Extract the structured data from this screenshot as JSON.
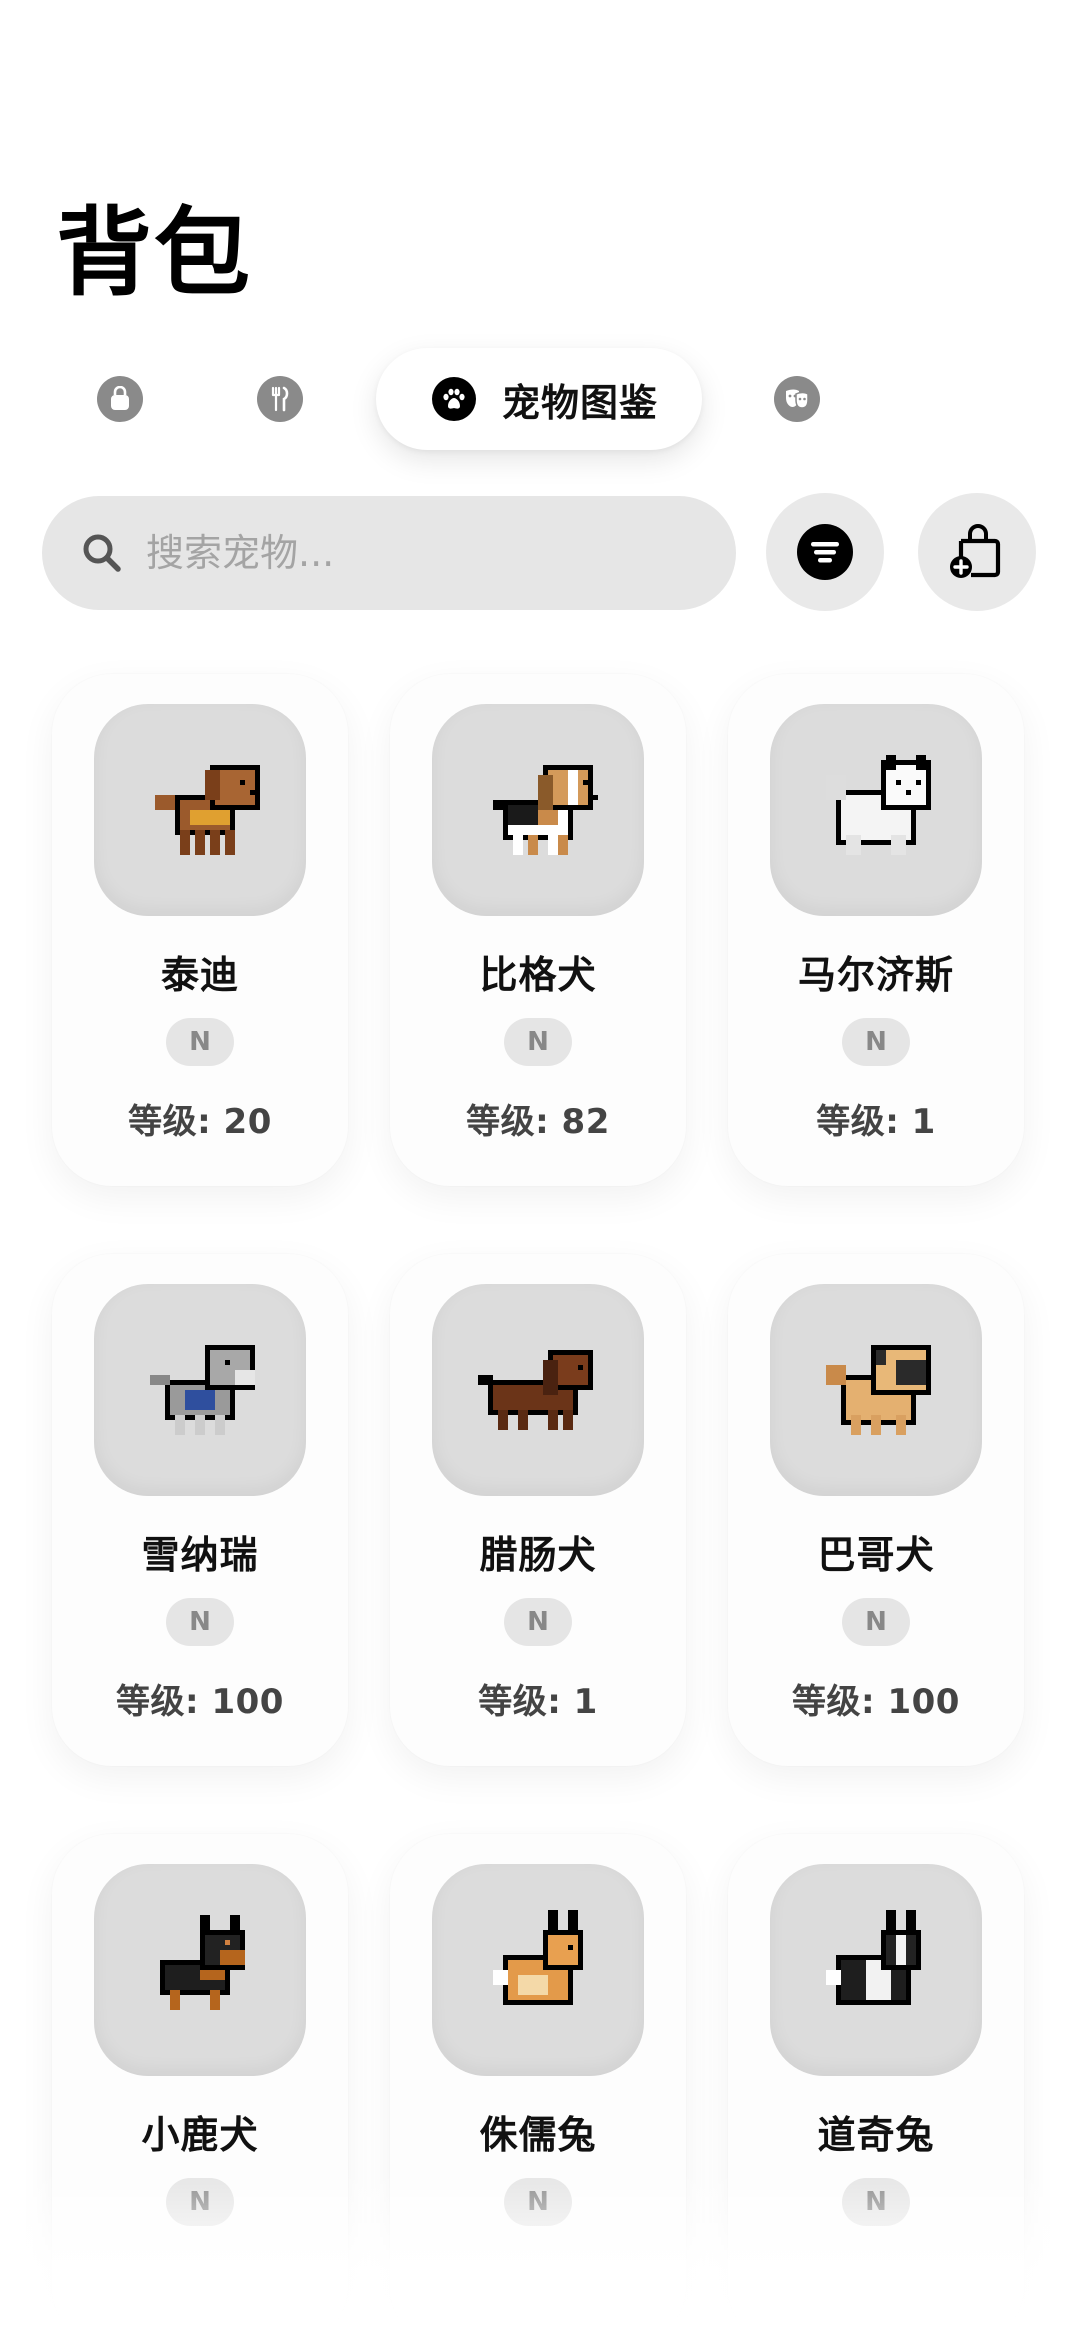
{
  "page": {
    "title": "背包"
  },
  "tabs": [
    {
      "name": "bag",
      "icon": "shopping-bag-icon"
    },
    {
      "name": "food",
      "icon": "fork-knife-icon"
    },
    {
      "name": "pets",
      "icon": "paw-icon",
      "label": "宠物图鉴",
      "active": true
    },
    {
      "name": "costume",
      "icon": "theater-masks-icon"
    }
  ],
  "search": {
    "placeholder": "搜索宠物...",
    "value": ""
  },
  "actions": {
    "filter_icon": "filter-lines-icon",
    "add_icon": "bag-add-icon"
  },
  "pets": [
    {
      "name": "泰迪",
      "rarity": "N",
      "level": "等级: 20",
      "sprite": "teddy-dog"
    },
    {
      "name": "比格犬",
      "rarity": "N",
      "level": "等级: 82",
      "sprite": "beagle-dog"
    },
    {
      "name": "马尔济斯",
      "rarity": "N",
      "level": "等级: 1",
      "sprite": "maltese-dog"
    },
    {
      "name": "雪纳瑞",
      "rarity": "N",
      "level": "等级: 100",
      "sprite": "schnauzer-dog"
    },
    {
      "name": "腊肠犬",
      "rarity": "N",
      "level": "等级: 1",
      "sprite": "dachshund-dog"
    },
    {
      "name": "巴哥犬",
      "rarity": "N",
      "level": "等级: 100",
      "sprite": "pug-dog"
    },
    {
      "name": "小鹿犬",
      "rarity": "N",
      "level": "",
      "sprite": "min-pin-dog"
    },
    {
      "name": "侏儒兔",
      "rarity": "N",
      "level": "",
      "sprite": "dwarf-rabbit"
    },
    {
      "name": "道奇兔",
      "rarity": "N",
      "level": "",
      "sprite": "dutch-rabbit"
    }
  ],
  "colors": {
    "accent": "#000000",
    "search_bg": "#e6e6e6",
    "thumb_bg": "#dcdcdc",
    "rarity_bg": "#e5e5e5",
    "icon_gray": "#8a8a8a"
  }
}
